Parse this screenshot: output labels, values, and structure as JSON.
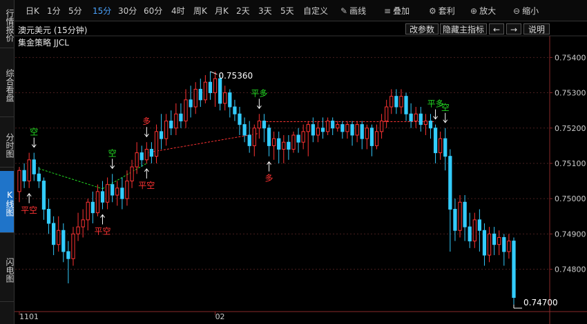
{
  "sidebar": {
    "items": [
      {
        "label": "行情报价",
        "active": false
      },
      {
        "label": "综合看盘",
        "active": false
      },
      {
        "label": "分时图",
        "active": false
      },
      {
        "label": "K线图",
        "active": true
      },
      {
        "label": "闪电图",
        "active": false
      }
    ]
  },
  "toolbar": {
    "periods": [
      "日K",
      "1分",
      "5分",
      "15分",
      "30分",
      "60分",
      "4时",
      "周K",
      "月K",
      "2天",
      "3天",
      "5天",
      "自定义"
    ],
    "active_period": "15分",
    "tools": [
      {
        "label": "画线",
        "icon": "pencil-icon"
      },
      {
        "label": "叠加",
        "icon": "layers-icon"
      },
      {
        "label": "套利",
        "icon": "gear-icon"
      },
      {
        "label": "放大",
        "icon": "zoom-in-icon"
      },
      {
        "label": "缩小",
        "icon": "zoom-out-icon"
      }
    ]
  },
  "chart_header": {
    "symbol": "澳元美元 (15分钟)",
    "strategy": "集金策略 JJCL",
    "buttons": [
      "改参数",
      "隐藏主指标"
    ],
    "nav_left": "←",
    "nav_right": "→",
    "help": "说明"
  },
  "chart_data": {
    "type": "candlestick",
    "y_range": [
      0.7468,
      0.7543
    ],
    "y_ticks": [
      "0.75400",
      "0.75300",
      "0.75200",
      "0.75100",
      "0.75000",
      "0.74900",
      "0.74800"
    ],
    "x_labels": [
      {
        "label": "1101",
        "index": 0
      },
      {
        "label": "02",
        "index": 40
      }
    ],
    "high_label": "0.75360",
    "last_price_label": "0.74700",
    "candles": [
      [
        0.7502,
        0.7508,
        0.7509,
        0.7499
      ],
      [
        0.7508,
        0.7505,
        0.751,
        0.7503
      ],
      [
        0.7505,
        0.7511,
        0.7513,
        0.7503
      ],
      [
        0.7511,
        0.7507,
        0.7513,
        0.7505
      ],
      [
        0.7507,
        0.7505,
        0.7509,
        0.7503
      ],
      [
        0.7505,
        0.7497,
        0.7506,
        0.7494
      ],
      [
        0.7497,
        0.7493,
        0.75,
        0.749
      ],
      [
        0.7493,
        0.7487,
        0.7495,
        0.7484
      ],
      [
        0.7487,
        0.7491,
        0.7495,
        0.7485
      ],
      [
        0.7491,
        0.7485,
        0.7493,
        0.7482
      ],
      [
        0.7485,
        0.7483,
        0.7488,
        0.7476
      ],
      [
        0.7483,
        0.749,
        0.7492,
        0.7481
      ],
      [
        0.749,
        0.7492,
        0.7496,
        0.7488
      ],
      [
        0.7492,
        0.7494,
        0.7497,
        0.7489
      ],
      [
        0.7494,
        0.7499,
        0.75,
        0.7491
      ],
      [
        0.7499,
        0.7496,
        0.7502,
        0.7493
      ],
      [
        0.7496,
        0.7502,
        0.7504,
        0.7495
      ],
      [
        0.7502,
        0.7499,
        0.7505,
        0.7497
      ],
      [
        0.7499,
        0.7504,
        0.7506,
        0.7497
      ],
      [
        0.7504,
        0.7501,
        0.7507,
        0.7499
      ],
      [
        0.7501,
        0.7503,
        0.7505,
        0.7498
      ],
      [
        0.7503,
        0.75,
        0.7506,
        0.7497
      ],
      [
        0.75,
        0.7505,
        0.7508,
        0.7498
      ],
      [
        0.7505,
        0.7509,
        0.7511,
        0.7503
      ],
      [
        0.7509,
        0.7513,
        0.7516,
        0.7507
      ],
      [
        0.7513,
        0.7511,
        0.7515,
        0.7509
      ],
      [
        0.7511,
        0.7514,
        0.7516,
        0.751
      ],
      [
        0.7514,
        0.7512,
        0.7516,
        0.751
      ],
      [
        0.7512,
        0.7519,
        0.7521,
        0.751
      ],
      [
        0.7519,
        0.7517,
        0.7524,
        0.7514
      ],
      [
        0.7517,
        0.7522,
        0.7524,
        0.7515
      ],
      [
        0.7522,
        0.752,
        0.7525,
        0.7518
      ],
      [
        0.752,
        0.7524,
        0.7527,
        0.7518
      ],
      [
        0.7524,
        0.7522,
        0.7527,
        0.752
      ],
      [
        0.7522,
        0.7528,
        0.7531,
        0.752
      ],
      [
        0.7528,
        0.7526,
        0.7532,
        0.7523
      ],
      [
        0.7526,
        0.7531,
        0.7533,
        0.7524
      ],
      [
        0.7531,
        0.7528,
        0.7534,
        0.7526
      ],
      [
        0.7528,
        0.7533,
        0.7535,
        0.7527
      ],
      [
        0.7533,
        0.753,
        0.7536,
        0.7528
      ],
      [
        0.753,
        0.7534,
        0.7536,
        0.7526
      ],
      [
        0.7534,
        0.7527,
        0.7535,
        0.7525
      ],
      [
        0.7527,
        0.753,
        0.7532,
        0.7525
      ],
      [
        0.753,
        0.7526,
        0.7531,
        0.7523
      ],
      [
        0.7526,
        0.7524,
        0.7528,
        0.7522
      ],
      [
        0.7524,
        0.7521,
        0.7526,
        0.7518
      ],
      [
        0.7521,
        0.7518,
        0.7523,
        0.7516
      ],
      [
        0.7518,
        0.7515,
        0.7522,
        0.7513
      ],
      [
        0.7515,
        0.752,
        0.7521,
        0.7512
      ],
      [
        0.752,
        0.7522,
        0.7524,
        0.7517
      ],
      [
        0.7522,
        0.752,
        0.7524,
        0.7516
      ],
      [
        0.752,
        0.7515,
        0.7521,
        0.7512
      ],
      [
        0.7515,
        0.7517,
        0.7519,
        0.7511
      ],
      [
        0.7517,
        0.7514,
        0.7519,
        0.751
      ],
      [
        0.7514,
        0.7516,
        0.7518,
        0.751
      ],
      [
        0.7516,
        0.7514,
        0.7518,
        0.7511
      ],
      [
        0.7514,
        0.7518,
        0.7519,
        0.7513
      ],
      [
        0.7518,
        0.7516,
        0.752,
        0.7513
      ],
      [
        0.7516,
        0.7519,
        0.7521,
        0.7514
      ],
      [
        0.7519,
        0.7521,
        0.7522,
        0.7512
      ],
      [
        0.7521,
        0.7518,
        0.7523,
        0.7516
      ],
      [
        0.7518,
        0.752,
        0.7522,
        0.7516
      ],
      [
        0.752,
        0.7519,
        0.7523,
        0.7517
      ],
      [
        0.7519,
        0.7522,
        0.7523,
        0.7518
      ],
      [
        0.7522,
        0.752,
        0.7523,
        0.7518
      ],
      [
        0.752,
        0.7521,
        0.7522,
        0.7519
      ],
      [
        0.7521,
        0.7519,
        0.7522,
        0.7517
      ],
      [
        0.7519,
        0.7521,
        0.7522,
        0.7517
      ],
      [
        0.7521,
        0.7518,
        0.7522,
        0.7515
      ],
      [
        0.7518,
        0.7521,
        0.7522,
        0.7516
      ],
      [
        0.7521,
        0.7517,
        0.7522,
        0.7514
      ],
      [
        0.7517,
        0.752,
        0.7521,
        0.7514
      ],
      [
        0.752,
        0.7515,
        0.7521,
        0.7512
      ],
      [
        0.7515,
        0.7519,
        0.7521,
        0.7514
      ],
      [
        0.7519,
        0.7522,
        0.7524,
        0.7517
      ],
      [
        0.7522,
        0.7526,
        0.7528,
        0.752
      ],
      [
        0.7526,
        0.7529,
        0.7531,
        0.7524
      ],
      [
        0.7529,
        0.7526,
        0.7531,
        0.7524
      ],
      [
        0.7526,
        0.7529,
        0.7531,
        0.7524
      ],
      [
        0.7529,
        0.7524,
        0.753,
        0.7522
      ],
      [
        0.7524,
        0.7522,
        0.7527,
        0.752
      ],
      [
        0.7522,
        0.7524,
        0.7526,
        0.752
      ],
      [
        0.7524,
        0.7521,
        0.7526,
        0.7519
      ],
      [
        0.7521,
        0.7522,
        0.7524,
        0.7518
      ],
      [
        0.7522,
        0.752,
        0.7524,
        0.7517
      ],
      [
        0.752,
        0.7513,
        0.7521,
        0.751
      ],
      [
        0.7513,
        0.7517,
        0.7519,
        0.7511
      ],
      [
        0.7517,
        0.7512,
        0.752,
        0.7508
      ],
      [
        0.7512,
        0.7497,
        0.7514,
        0.7485
      ],
      [
        0.7497,
        0.7491,
        0.75,
        0.7488
      ],
      [
        0.7491,
        0.7499,
        0.7501,
        0.7489
      ],
      [
        0.7499,
        0.7492,
        0.7501,
        0.7488
      ],
      [
        0.7492,
        0.7488,
        0.7496,
        0.7486
      ],
      [
        0.7488,
        0.7494,
        0.7496,
        0.7486
      ],
      [
        0.7494,
        0.7491,
        0.7497,
        0.7485
      ],
      [
        0.7491,
        0.7484,
        0.7493,
        0.7481
      ],
      [
        0.7484,
        0.749,
        0.7492,
        0.7482
      ],
      [
        0.749,
        0.7487,
        0.7492,
        0.7484
      ],
      [
        0.7487,
        0.7489,
        0.7491,
        0.7484
      ],
      [
        0.7489,
        0.7485,
        0.749,
        0.7481
      ],
      [
        0.7485,
        0.7488,
        0.749,
        0.7483
      ],
      [
        0.7488,
        0.7472,
        0.7489,
        0.747
      ]
    ],
    "signals": [
      {
        "index": 3,
        "label": "空",
        "side": "above",
        "color": "#22dd22"
      },
      {
        "index": 2,
        "label": "平空",
        "side": "below",
        "color": "#ff3333"
      },
      {
        "index": 19,
        "label": "空",
        "side": "above",
        "color": "#22dd22"
      },
      {
        "index": 17,
        "label": "平空",
        "side": "below",
        "color": "#ff3333"
      },
      {
        "index": 26,
        "label": "平空",
        "side": "below",
        "color": "#ff3333"
      },
      {
        "index": 26,
        "label": "多",
        "side": "above",
        "color": "#ff3333"
      },
      {
        "index": 49,
        "label": "平多",
        "side": "above",
        "color": "#22dd22"
      },
      {
        "index": 51,
        "label": "多",
        "side": "below",
        "color": "#ff3333"
      },
      {
        "index": 85,
        "label": "平多",
        "side": "above",
        "color": "#22dd22"
      },
      {
        "index": 87,
        "label": "空",
        "side": "above",
        "color": "#22dd22"
      }
    ],
    "colors": {
      "up": "#ff3333",
      "down": "#33ccff",
      "grid": "#4a1f1f",
      "axis_text": "#cccccc"
    }
  }
}
